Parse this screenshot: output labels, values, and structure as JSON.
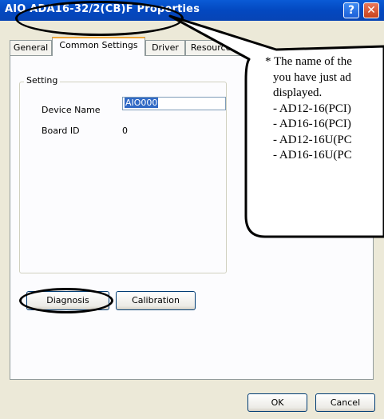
{
  "window": {
    "title": "AIO ADA16-32/2(CB)F Properties",
    "help_glyph": "?",
    "close_glyph": "✕"
  },
  "tabs": [
    {
      "label": "General",
      "active": false
    },
    {
      "label": "Common Settings",
      "active": true
    },
    {
      "label": "Driver",
      "active": false
    },
    {
      "label": "Resources",
      "active": false
    }
  ],
  "setting": {
    "group_label": "Setting",
    "device_name_label": "Device Name",
    "device_name_value": "AIO000",
    "board_id_label": "Board ID",
    "board_id_value": "0"
  },
  "buttons": {
    "diagnosis": "Diagnosis",
    "calibration": "Calibration",
    "ok": "OK",
    "cancel": "Cancel"
  },
  "callout": {
    "lines": [
      "* The name of the",
      "you have just ad",
      "displayed.",
      "- AD12-16(PCI)",
      "- AD16-16(PCI)",
      "- AD12-16U(PC",
      "- AD16-16U(PC"
    ]
  },
  "colors": {
    "titlebar": "#0348c0",
    "dialog_bg": "#ece9d8",
    "panel_bg": "#fcfcfe",
    "active_tab_accent": "#f0a93a",
    "close_button": "#c8421c"
  }
}
